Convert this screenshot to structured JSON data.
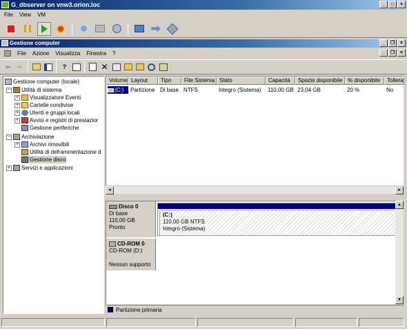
{
  "vm_window": {
    "title": "G_dbserver on vnw3.orion.loc",
    "menu": [
      "File",
      "View",
      "VM"
    ]
  },
  "mmc_window": {
    "title": "Gestione computer",
    "menu": [
      "File",
      "Azione",
      "Visualizza",
      "Finestra",
      "?"
    ]
  },
  "tree": {
    "root": "Gestione computer (locale)",
    "utilita": "Utilità di sistema",
    "visualizzatore": "Visualizzatore Eventi",
    "cartelle": "Cartelle condivise",
    "utenti": "Utenti e gruppi locali",
    "avvisi": "Avvisi e registri di prestazior",
    "periferiche": "Gestione periferiche",
    "archiviazione": "Archiviazione",
    "rimovibili": "Archivi rimovibili",
    "deframmentazione": "Utilità di deframmentazione d",
    "gestione_disco": "Gestione disco",
    "servizi": "Servizi e applicazioni"
  },
  "volume_table": {
    "headers": [
      "Volume",
      "Layout",
      "Tipo",
      "File Sistema",
      "Stato",
      "Capacità",
      "Spazio disponibile",
      "% disponibile",
      "Tolleran"
    ],
    "row": [
      "(C:)",
      "Partizione",
      "Di base",
      "NTFS",
      "Integro (Sistema)",
      "110,00 GB",
      "23,04 GB",
      "20 %",
      "No"
    ]
  },
  "disks": {
    "disk0": {
      "name": "Disco 0",
      "type": "Di base",
      "size": "110,00 GB",
      "status": "Pronto",
      "partition_name": "(C:)",
      "partition_size": "110,00 GB NTFS",
      "partition_status": "Integro (Sistema)"
    },
    "cdrom": {
      "name": "CD-ROM 0",
      "drive": "CD-ROM (D:)",
      "media": "Nessun supporto"
    }
  },
  "legend": {
    "label": "Partizione primaria",
    "color": "#00007f"
  },
  "colors": {
    "title_bar": "#0a246a",
    "chrome": "#d4d0c8"
  }
}
